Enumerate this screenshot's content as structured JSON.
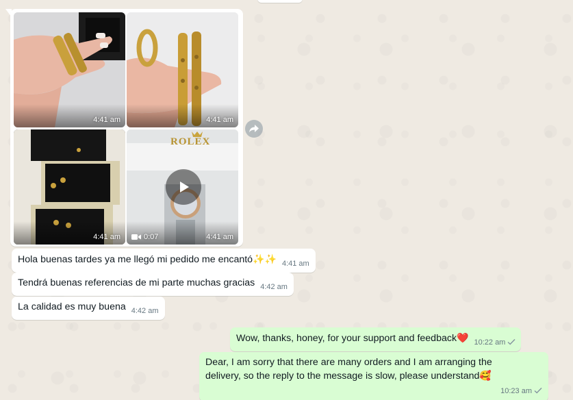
{
  "theme": {
    "chat_background": "#efeae2",
    "incoming_bubble": "#ffffff",
    "outgoing_bubble": "#d9fdd3",
    "meta_text": "#667781"
  },
  "media_group": {
    "tiles": [
      {
        "icon": "photo",
        "time": "4:41 am",
        "subject": "gold bracelet on hand"
      },
      {
        "icon": "photo",
        "time": "4:41 am",
        "subject": "gold ring and bracelet on hand"
      },
      {
        "icon": "photo",
        "time": "4:41 am",
        "subject": "jewelry boxes with clover pieces"
      },
      {
        "icon": "video",
        "time": "4:41 am",
        "duration": "0:07",
        "brand_text": "ROLEX"
      }
    ],
    "forward_icon": "forward-icon"
  },
  "messages": [
    {
      "direction": "in",
      "text": "Hola buenas tardes ya me llegó mi pedido me encantó",
      "emoji": "✨✨",
      "time": "4:41 am"
    },
    {
      "direction": "in",
      "text": "Tendrá buenas referencias de mi parte muchas gracias",
      "time": "4:42 am"
    },
    {
      "direction": "in",
      "text": "La calidad es muy buena",
      "time": "4:42 am"
    },
    {
      "direction": "out",
      "text": "Wow, thanks, honey, for your support and feedback",
      "emoji": "❤️",
      "time": "10:22 am",
      "status": "sent"
    },
    {
      "direction": "out",
      "line1": "Dear, I am sorry that there are many orders and I am arranging the",
      "line2": "delivery, so the reply to the message is slow, please understand",
      "emoji": "🥰",
      "time": "10:23 am",
      "status": "sent"
    }
  ]
}
